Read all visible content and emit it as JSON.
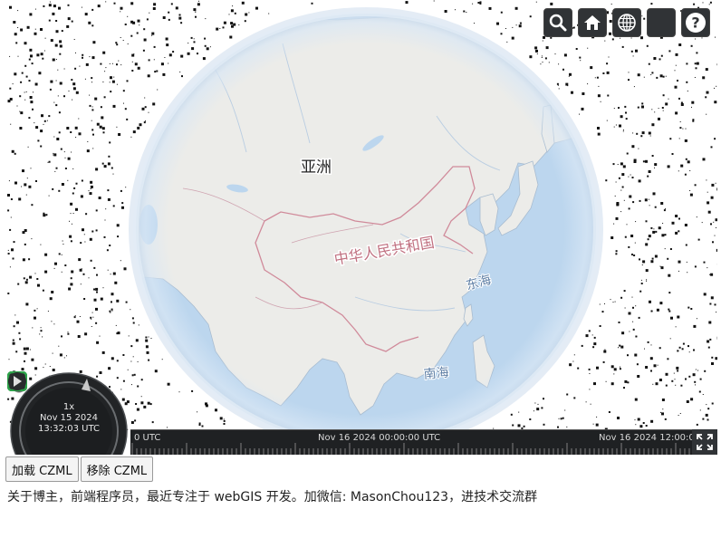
{
  "map": {
    "labels": {
      "asia": "亚洲",
      "china": "中华人民共和国",
      "east_sea": "东海",
      "south_sea": "南海"
    }
  },
  "toolbar": {
    "buttons": [
      {
        "name": "search-button",
        "icon": "search-icon"
      },
      {
        "name": "home-button",
        "icon": "home-icon"
      },
      {
        "name": "scene-mode-button",
        "icon": "globe-icon"
      },
      {
        "name": "base-layer-picker-button",
        "icon": "layer-thumbnail-icon"
      },
      {
        "name": "help-button",
        "icon": "help-icon"
      }
    ]
  },
  "animation": {
    "speed": "1x",
    "date": "Nov 15 2024",
    "time": "13:32:03 UTC",
    "state": "playing"
  },
  "timeline": {
    "labels": [
      "0 UTC",
      "Nov 16 2024 00:00:00 UTC",
      "Nov 16 2024 12:00:0"
    ]
  },
  "buttons": {
    "load_czml": "加载 CZML",
    "remove_czml": "移除 CZML"
  },
  "about_text": "关于博主，前端程序员，最近专注于 webGIS 开发。加微信: MasonChou123，进技术交流群",
  "colors": {
    "ocean": "#bcd6ee",
    "land": "#ecece9",
    "border": "#d08a9a",
    "widget_bg": "#303336",
    "active": "#2ea34a"
  }
}
